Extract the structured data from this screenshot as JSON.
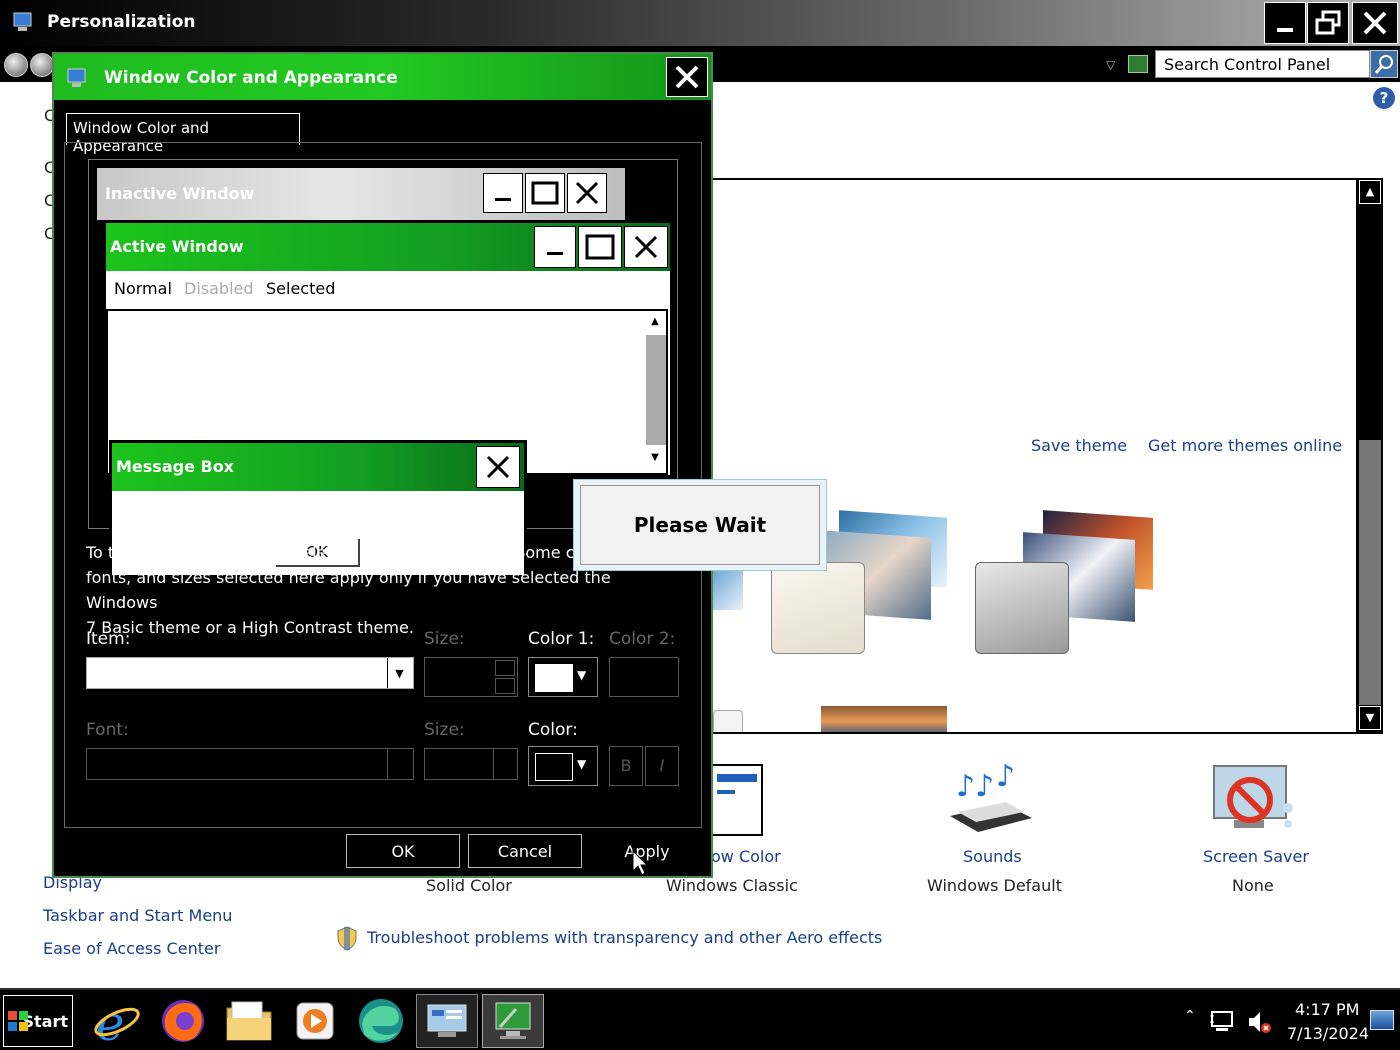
{
  "window": {
    "title": "Personalization",
    "search_placeholder": "Search Control Panel"
  },
  "left_nav": {
    "truncated_top": [
      "C",
      "C",
      "C",
      "C"
    ],
    "display": "Display",
    "taskbar": "Taskbar and Start Menu",
    "ease": "Ease of Access Center"
  },
  "themes": {
    "save": "Save theme",
    "get_more": "Get more themes online"
  },
  "bottom_items": [
    {
      "title": "ow Color",
      "sub": "Solid Color"
    },
    {
      "title": "",
      "sub": "Windows Classic"
    },
    {
      "title": "Sounds",
      "sub": "Windows Default"
    },
    {
      "title": "Screen Saver",
      "sub": "None"
    }
  ],
  "troubleshoot": "Troubleshoot problems with transparency and other Aero effects",
  "dialog": {
    "title": "Window Color and Appearance",
    "tab": "Window Color and Appearance",
    "preview": {
      "inactive": "Inactive Window",
      "active": "Active Window",
      "menu": [
        "Normal",
        "Disabled",
        "Selected"
      ],
      "msgbox": "Message Box",
      "ok": "OK"
    },
    "info": "To turn on Windows Aero, select a Windows 7 theme.  Some colors, fonts, and sizes selected here apply only if you have selected the Windows 7 Basic theme or a High Contrast theme.",
    "info_lines": [
      "To turn on Windows Aero, select a Windows 7 theme.  Some c",
      "fonts, and sizes selected here apply only if you have selected the Windows",
      "7 Basic theme or a High Contrast theme."
    ],
    "labels": {
      "item": "Item:",
      "size": "Size:",
      "color1": "Color 1:",
      "color2": "Color 2:",
      "font": "Font:",
      "size2": "Size:",
      "color": "Color:",
      "bold": "B",
      "italic": "I"
    },
    "buttons": {
      "ok": "OK",
      "cancel": "Cancel",
      "apply": "Apply"
    }
  },
  "please_wait": "Please Wait",
  "taskbar": {
    "start": "Start",
    "time": "4:17 PM",
    "date": "7/13/2024"
  }
}
